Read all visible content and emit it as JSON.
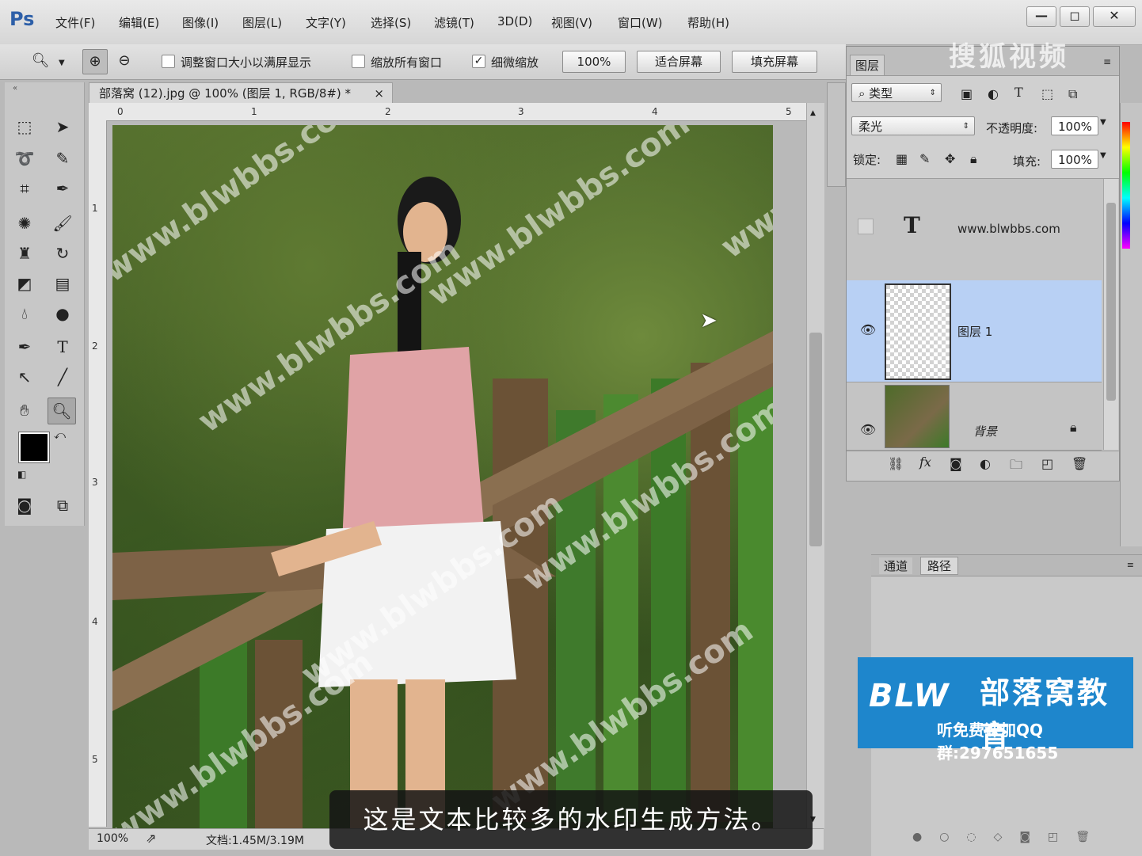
{
  "app": {
    "logo": "Ps"
  },
  "menu": [
    "文件(F)",
    "编辑(E)",
    "图像(I)",
    "图层(L)",
    "文字(Y)",
    "选择(S)",
    "滤镜(T)",
    "3D(D)",
    "视图(V)",
    "窗口(W)",
    "帮助(H)"
  ],
  "window_buttons": {
    "minimize": "—",
    "restore": "◻",
    "close": "✕"
  },
  "options": {
    "resize_window": "调整窗口大小以满屏显示",
    "zoom_all": "缩放所有窗口",
    "scrubby_zoom": "细微缩放",
    "scrubby_checked": true,
    "zoom_100": "100%",
    "fit_screen": "适合屏幕",
    "fill_screen": "填充屏幕"
  },
  "document": {
    "tab_title": "部落窝 (12).jpg @ 100% (图层 1, RGB/8#) *",
    "close": "×",
    "ruler_h": [
      "0",
      "1",
      "2",
      "3",
      "4",
      "5"
    ],
    "ruler_v": [
      "1",
      "2",
      "3",
      "4",
      "5"
    ],
    "watermark_text": "www.blwbbs.com"
  },
  "status": {
    "zoom": "100%",
    "doc_info": "文档:1.45M/3.19M"
  },
  "layers_panel": {
    "tab": "图层",
    "filter_kind": "类型",
    "blend_mode": "柔光",
    "opacity_label": "不透明度:",
    "opacity": "100%",
    "lock_label": "锁定:",
    "fill_label": "填充:",
    "fill": "100%",
    "layers": [
      {
        "name": "www.blwbbs.com",
        "kind": "text",
        "visible": false,
        "selected": false,
        "thumb_glyph": "T"
      },
      {
        "name": "图层 1",
        "kind": "pixel",
        "visible": true,
        "selected": true
      },
      {
        "name": "背景",
        "kind": "background",
        "visible": true,
        "selected": false,
        "locked": true
      }
    ],
    "footer_icons": [
      "link-icon",
      "fx-icon",
      "mask-icon",
      "adjustment-icon",
      "group-folder-icon",
      "new-layer-icon",
      "trash-icon"
    ],
    "fx_label": "fx"
  },
  "channels_panel": {
    "tabs": [
      "通道",
      "路径"
    ]
  },
  "subtitle": "这是文本比较多的水印生成方法。",
  "overlay": {
    "sohu_watermark": "搜狐视频",
    "brand_logo": "BLW",
    "brand_name": "部落窝教育",
    "brand_qq": "听免费课加QQ群:297651655"
  },
  "colors": {
    "accent": "#2d5fa8",
    "selected_layer": "#b8d0f4",
    "brand_blue": "#1e86cc"
  }
}
